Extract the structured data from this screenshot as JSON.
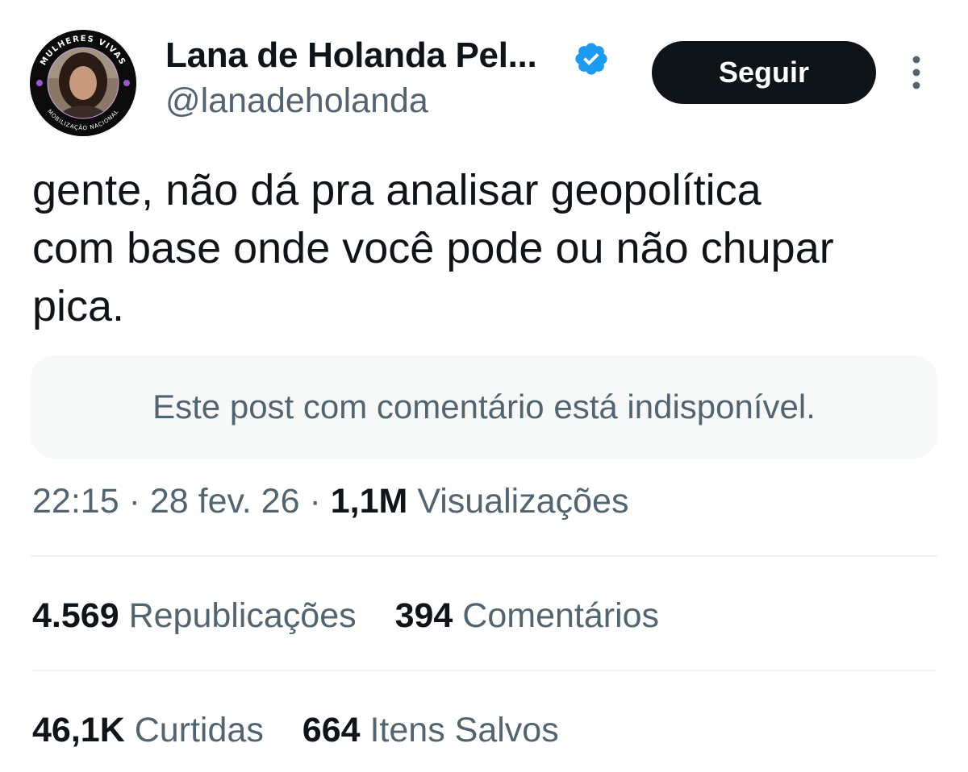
{
  "author": {
    "display_name": "Lana de Holanda Pel...",
    "handle": "@lanadeholanda",
    "verified": true,
    "verified_icon": "verified-badge-icon",
    "avatar_ring_text_top": "MULHERES VIVAS",
    "avatar_ring_text_bottom": "MOBILIZAÇÃO NACIONAL"
  },
  "actions": {
    "follow_label": "Seguir",
    "more_icon": "more-vertical-icon"
  },
  "tweet": {
    "text_lines": [
      "gente, não dá pra analisar geopolítica",
      "com base onde você pode ou não chupar",
      "pica."
    ],
    "quote_unavailable": "Este post com comentário está indisponível."
  },
  "meta": {
    "time": "22:15",
    "separator": "·",
    "date": "28 fev. 26",
    "views_count": "1,1M",
    "views_label": "Visualizações"
  },
  "stats": {
    "reposts_count": "4.569",
    "reposts_label": "Republicações",
    "comments_count": "394",
    "comments_label": "Comentários",
    "likes_count": "46,1K",
    "likes_label": "Curtidas",
    "saves_count": "664",
    "saves_label": "Itens Salvos"
  },
  "colors": {
    "text_primary": "#0f1419",
    "text_secondary": "#536471",
    "verified_blue": "#1d9bf0",
    "button_bg": "#0f1419",
    "quote_bg": "#f7f9f9",
    "divider": "#eff3f4"
  }
}
